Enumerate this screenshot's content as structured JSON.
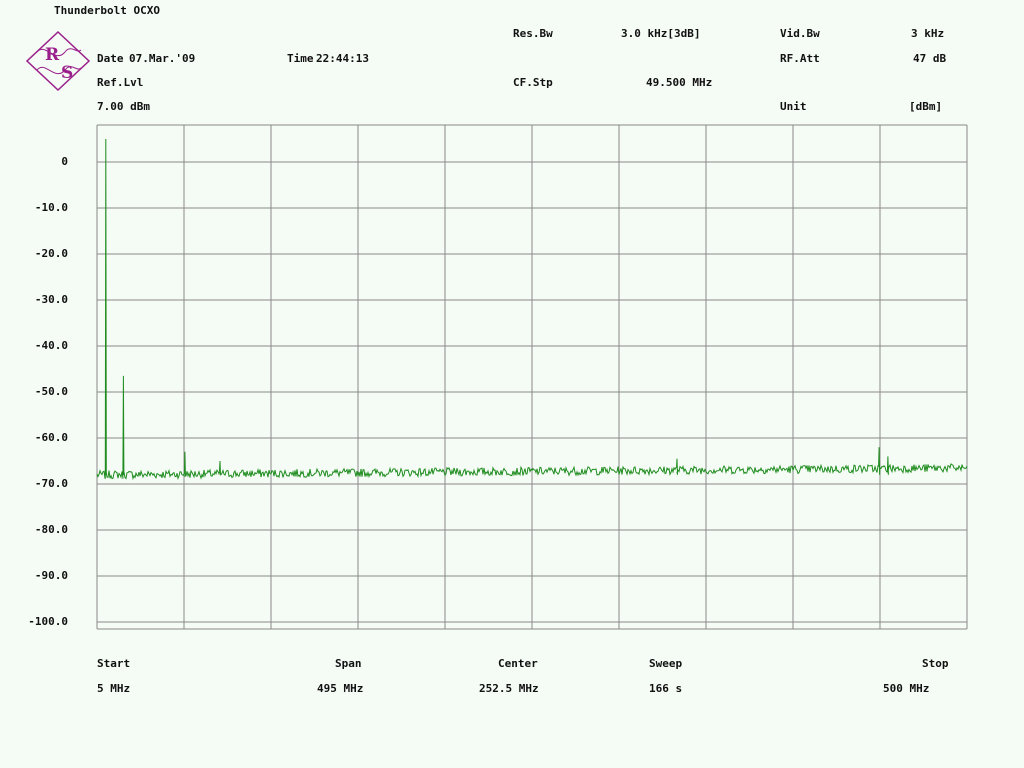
{
  "title": "Thunderbolt OCXO",
  "header": {
    "date_label": "Date",
    "date_value": "07.Mar.'09",
    "time_label": "Time",
    "time_value": "22:44:13",
    "ref_label": "Ref.Lvl",
    "ref_value": "7.00 dBm",
    "resbw_label": "Res.Bw",
    "resbw_value": "3.0 kHz[3dB]",
    "cfstp_label": "CF.Stp",
    "cfstp_value": "49.500 MHz",
    "vidbw_label": "Vid.Bw",
    "vidbw_value": "3 kHz",
    "rfatt_label": "RF.Att",
    "rfatt_value": "47 dB",
    "unit_label": "Unit",
    "unit_value": "[dBm]"
  },
  "footer": {
    "start_label": "Start",
    "start_value": "5 MHz",
    "span_label": "Span",
    "span_value": "495 MHz",
    "center_label": "Center",
    "center_value": "252.5 MHz",
    "sweep_label": "Sweep",
    "sweep_value": "166 s",
    "stop_label": "Stop",
    "stop_value": "500 MHz"
  },
  "logo": {
    "text": "R&S",
    "color": "#9a1f8a"
  },
  "colors": {
    "trace": "#1e8c1e",
    "grid": "#8a8a8a",
    "background": "#f5fbf5"
  },
  "chart_data": {
    "type": "line",
    "xlabel": "",
    "ylabel": "",
    "xlim": [
      5,
      500
    ],
    "ylim": [
      -100,
      7
    ],
    "y_tick_labels": [
      "0",
      "-10.0",
      "-20.0",
      "-30.0",
      "-40.0",
      "-50.0",
      "-60.0",
      "-70.0",
      "-80.0",
      "-90.0",
      "-100.0"
    ],
    "y_ticks": [
      0,
      -10,
      -20,
      -30,
      -40,
      -50,
      -60,
      -70,
      -80,
      -90,
      -100
    ],
    "x_divisions": 10,
    "grid": true,
    "noise_floor_start": -68,
    "noise_floor_end": -66.5,
    "peaks": [
      {
        "x": 10.0,
        "y": 5.0
      },
      {
        "x": 20.0,
        "y": -46.5
      },
      {
        "x": 55.0,
        "y": -63.0
      },
      {
        "x": 75.0,
        "y": -65.0
      },
      {
        "x": 335.0,
        "y": -64.5
      },
      {
        "x": 450.0,
        "y": -62.0
      },
      {
        "x": 455.0,
        "y": -64.0
      }
    ]
  }
}
